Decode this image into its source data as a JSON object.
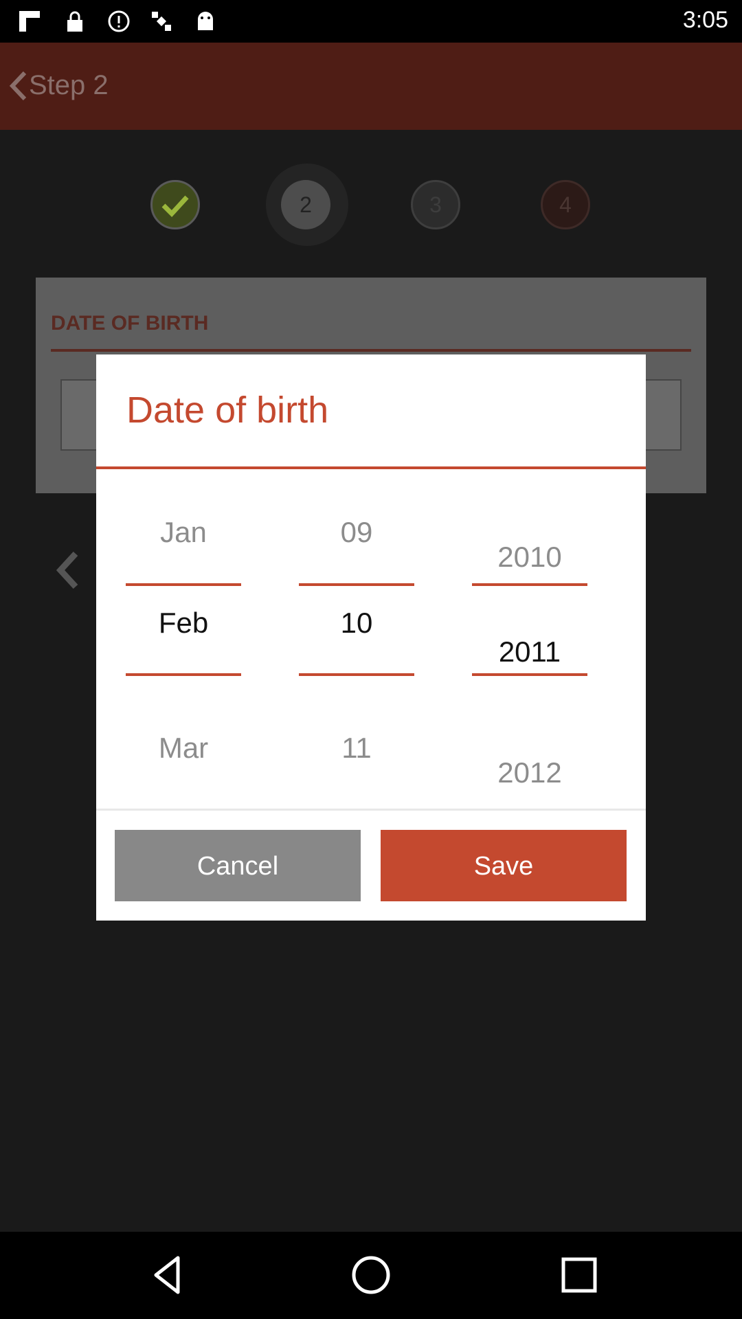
{
  "status_bar": {
    "time": "3:05",
    "icons": [
      "flipboard-icon",
      "lock-icon",
      "info-icon",
      "satellite-icon",
      "android-icon"
    ]
  },
  "app_bar": {
    "title": "Step 2",
    "back_icon": "chevron-left-icon"
  },
  "steps": {
    "items": [
      {
        "label": "",
        "state": "done",
        "icon": "check-icon"
      },
      {
        "label": "2",
        "state": "current"
      },
      {
        "label": "3",
        "state": "pending"
      },
      {
        "label": "4",
        "state": "pending"
      }
    ]
  },
  "form": {
    "section_label": "DATE OF BIRTH",
    "prev_icon": "chevron-left-icon"
  },
  "dialog": {
    "title": "Date of birth",
    "month": {
      "prev": "Jan",
      "selected": "Feb",
      "next": "Mar"
    },
    "day": {
      "prev": "09",
      "selected": "10",
      "next": "11"
    },
    "year": {
      "prev": "2010",
      "selected": "2011",
      "next": "2012"
    },
    "cancel_label": "Cancel",
    "save_label": "Save"
  },
  "nav_bar": {
    "icons": [
      "back-icon",
      "home-icon",
      "recents-icon"
    ]
  },
  "colors": {
    "accent": "#c4492f",
    "app_bar": "#4f1d15",
    "cancel_button": "#888888"
  }
}
